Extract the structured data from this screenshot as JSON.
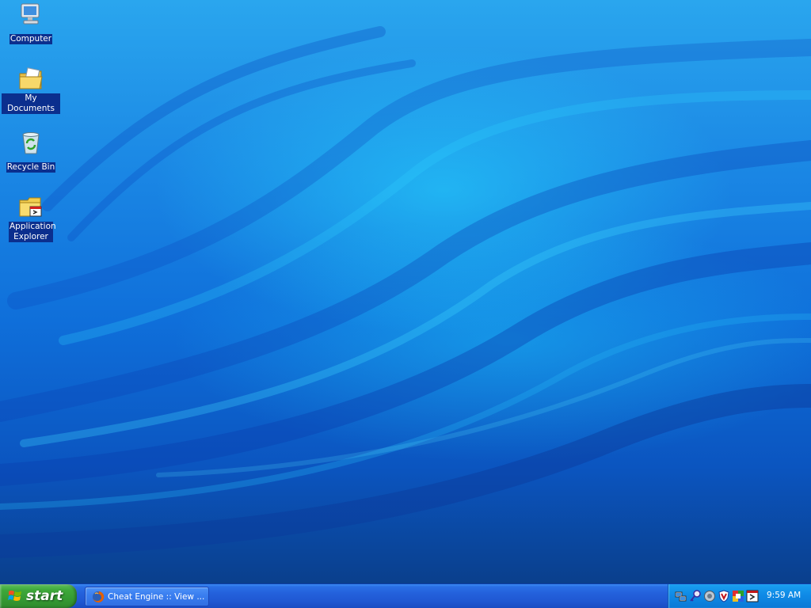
{
  "desktop": {
    "icons": [
      {
        "label": "Computer",
        "icon": "computer-icon"
      },
      {
        "label": "My Documents",
        "icon": "my-documents-icon"
      },
      {
        "label": "Recycle Bin",
        "icon": "recycle-bin-icon"
      },
      {
        "label": "Application Explorer",
        "icon": "application-explorer-icon"
      }
    ]
  },
  "taskbar": {
    "start_label": "start",
    "start_icon": "windows-logo-icon",
    "tasks": [
      {
        "label": "Cheat Engine :: View ...",
        "icon": "firefox-icon"
      }
    ],
    "tray": {
      "icons": [
        "network-connection-icon",
        "key-icon",
        "volume-icon",
        "antivirus-shield-icon",
        "colorful-app-icon",
        "arrow-app-icon"
      ],
      "clock": "9:59 AM"
    }
  },
  "colors": {
    "desktop_blue": "#1a86e4",
    "taskbar_blue": "#2360db",
    "start_green": "#359b33",
    "tray_blue": "#0f8ae6",
    "icon_label_highlight": "#0b2f8e"
  }
}
